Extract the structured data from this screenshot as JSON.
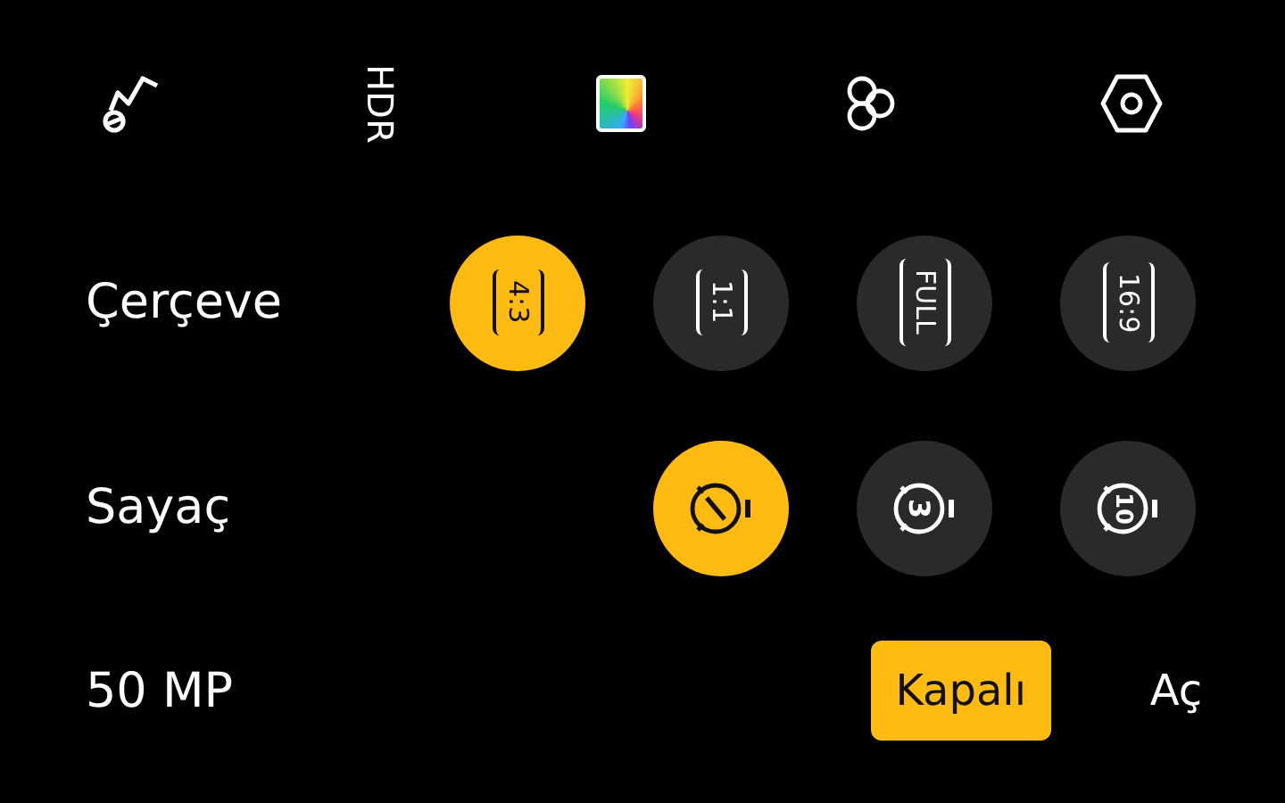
{
  "toolbar": [
    {
      "kind": "flash"
    },
    {
      "kind": "hdr",
      "label": "HDR"
    },
    {
      "kind": "color"
    },
    {
      "kind": "filter"
    },
    {
      "kind": "settings"
    }
  ],
  "frame": {
    "label": "Çerçeve",
    "options": [
      {
        "label": "4:3",
        "selected": true
      },
      {
        "label": "1:1",
        "selected": false
      },
      {
        "label": "FULL",
        "selected": false
      },
      {
        "label": "16:9",
        "selected": false
      }
    ]
  },
  "timer": {
    "label": "Sayaç",
    "options": [
      {
        "kind": "off",
        "selected": true
      },
      {
        "kind": "seconds",
        "label": "3",
        "selected": false
      },
      {
        "kind": "seconds",
        "label": "10",
        "selected": false
      }
    ]
  },
  "resolution": {
    "label": "50 MP",
    "options": [
      {
        "label": "Kapalı",
        "selected": true
      },
      {
        "label": "Aç",
        "selected": false
      }
    ]
  }
}
